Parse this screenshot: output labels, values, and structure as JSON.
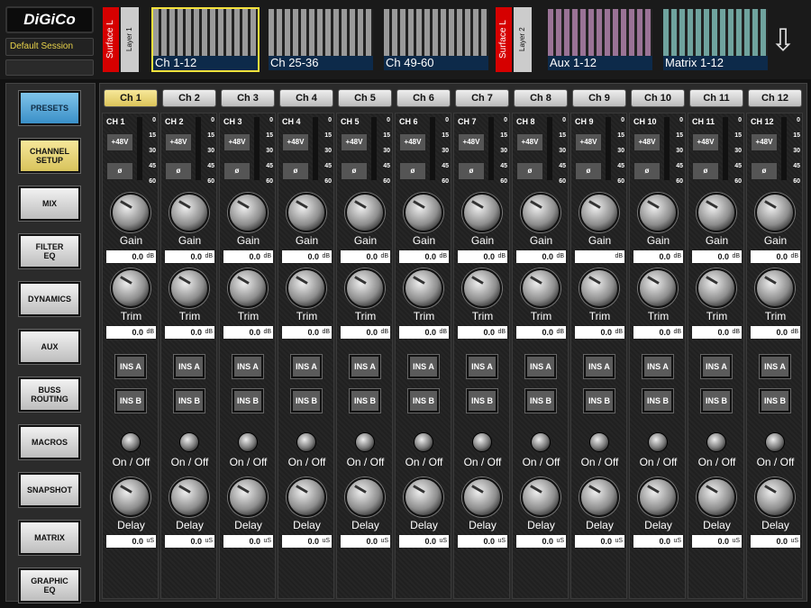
{
  "header": {
    "logo": "DiGiCo",
    "session": "Default Session",
    "surface_labels": [
      "Surface L",
      "Surface L"
    ],
    "layer_labels": [
      "Layer 1",
      "Layer 2"
    ],
    "banks": [
      {
        "label": "Ch 1-12",
        "color": "#9a9a9a",
        "selected": true
      },
      {
        "label": "Ch 25-36",
        "color": "#9a9a9a",
        "selected": false
      },
      {
        "label": "Ch 49-60",
        "color": "#9a9a9a",
        "selected": false
      },
      {
        "label": "Aux 1-12",
        "color": "#9a7396",
        "selected": false
      },
      {
        "label": "Matrix 1-12",
        "color": "#6fa39e",
        "selected": false
      }
    ],
    "arrow_icon": "down-arrow-icon"
  },
  "sidebar": {
    "buttons": [
      "PRESETS",
      "CHANNEL\nSETUP",
      "MIX",
      "FILTER\nEQ",
      "DYNAMICS",
      "AUX",
      "BUSS\nROUTING",
      "MACROS",
      "SNAPSHOT",
      "MATRIX",
      "GRAPHIC\nEQ"
    ]
  },
  "tabs": [
    "Ch 1",
    "Ch 2",
    "Ch 3",
    "Ch 4",
    "Ch 5",
    "Ch 6",
    "Ch 7",
    "Ch 8",
    "Ch 9",
    "Ch 10",
    "Ch 11",
    "Ch 12"
  ],
  "strip_names": [
    "CH 1",
    "CH 2",
    "CH 3",
    "CH 4",
    "CH 5",
    "CH 6",
    "CH 7",
    "CH 8",
    "CH 9",
    "CH 10",
    "CH 11",
    "CH 12"
  ],
  "meter_scale": [
    "0",
    "15",
    "30",
    "45",
    "60"
  ],
  "controls": {
    "phantom": "+48V",
    "phase": "ø",
    "gain_label": "Gain",
    "trim_label": "Trim",
    "ins_a": "INS A",
    "ins_b": "INS B",
    "onoff_label": "On / Off",
    "delay_label": "Delay",
    "db_unit": "dB",
    "us_unit": "uS"
  },
  "gain_values": [
    "0.0",
    "0.0",
    "0.0",
    "0.0",
    "0.0",
    "0.0",
    "0.0",
    "0.0",
    "",
    "0.0",
    "0.0",
    "0.0"
  ],
  "trim_values": [
    "0.0",
    "0.0",
    "0.0",
    "0.0",
    "0.0",
    "0.0",
    "0.0",
    "0.0",
    "0.0",
    "0.0",
    "0.0",
    "0.0"
  ],
  "delay_values": [
    "0.0",
    "0.0",
    "0.0",
    "0.0",
    "0.0",
    "0.0",
    "0.0",
    "0.0",
    "0.0",
    "0.0",
    "0.0",
    "0.0"
  ]
}
